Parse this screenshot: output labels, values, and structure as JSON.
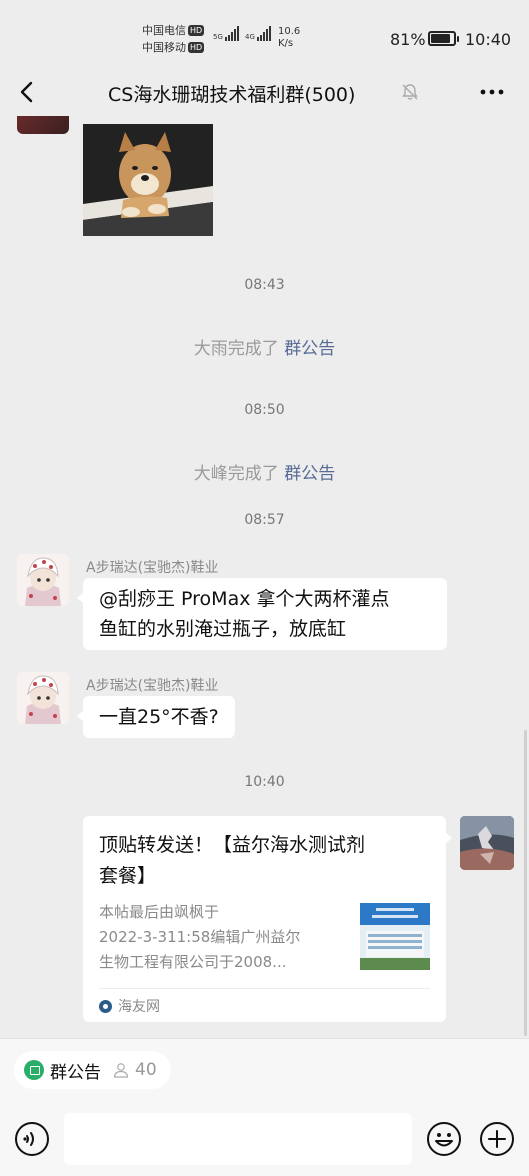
{
  "status_bar": {
    "carrier_1": "中国电信",
    "carrier_2": "中国移动",
    "hd_badge": "HD",
    "net_1": "5G",
    "net_2": "4G",
    "speed_value": "10.6",
    "speed_unit": "K/s",
    "battery_pct": "81%",
    "time": "10:40"
  },
  "nav": {
    "title": "CS海水珊瑚技术福利群(500)"
  },
  "messages": {
    "ts_1": "08:43",
    "sys_1_actor": "大雨完成了 ",
    "sys_1_link": "群公告",
    "ts_2": "08:50",
    "sys_2_actor": "大峰完成了 ",
    "sys_2_link": "群公告",
    "ts_3": "08:57",
    "msg_1_sender": "A步瑞达(宝驰杰)鞋业",
    "msg_1_line_1": "@刮痧王 ProMax 拿个大两杯灌点",
    "msg_1_line_2": "鱼缸的水别淹过瓶子，放底缸",
    "msg_2_sender": "A步瑞达(宝驰杰)鞋业",
    "msg_2_text": "一直25°不香?",
    "ts_4": "10:40",
    "card": {
      "title_line_1": "顶贴转发送！【益尔海水测试剂",
      "title_line_2": "套餐】",
      "desc_line_1": "本帖最后由飒枫于",
      "desc_line_2": "2022-3-311:58编辑广州益尔",
      "desc_line_3": "生物工程有限公司于2008...",
      "source": "海友网"
    }
  },
  "bottom": {
    "notice_label": "群公告",
    "member_count": "40",
    "input_value": ""
  },
  "colors": {
    "background": "#ededed",
    "link": "#576b95",
    "notice_green": "#2aae67"
  }
}
